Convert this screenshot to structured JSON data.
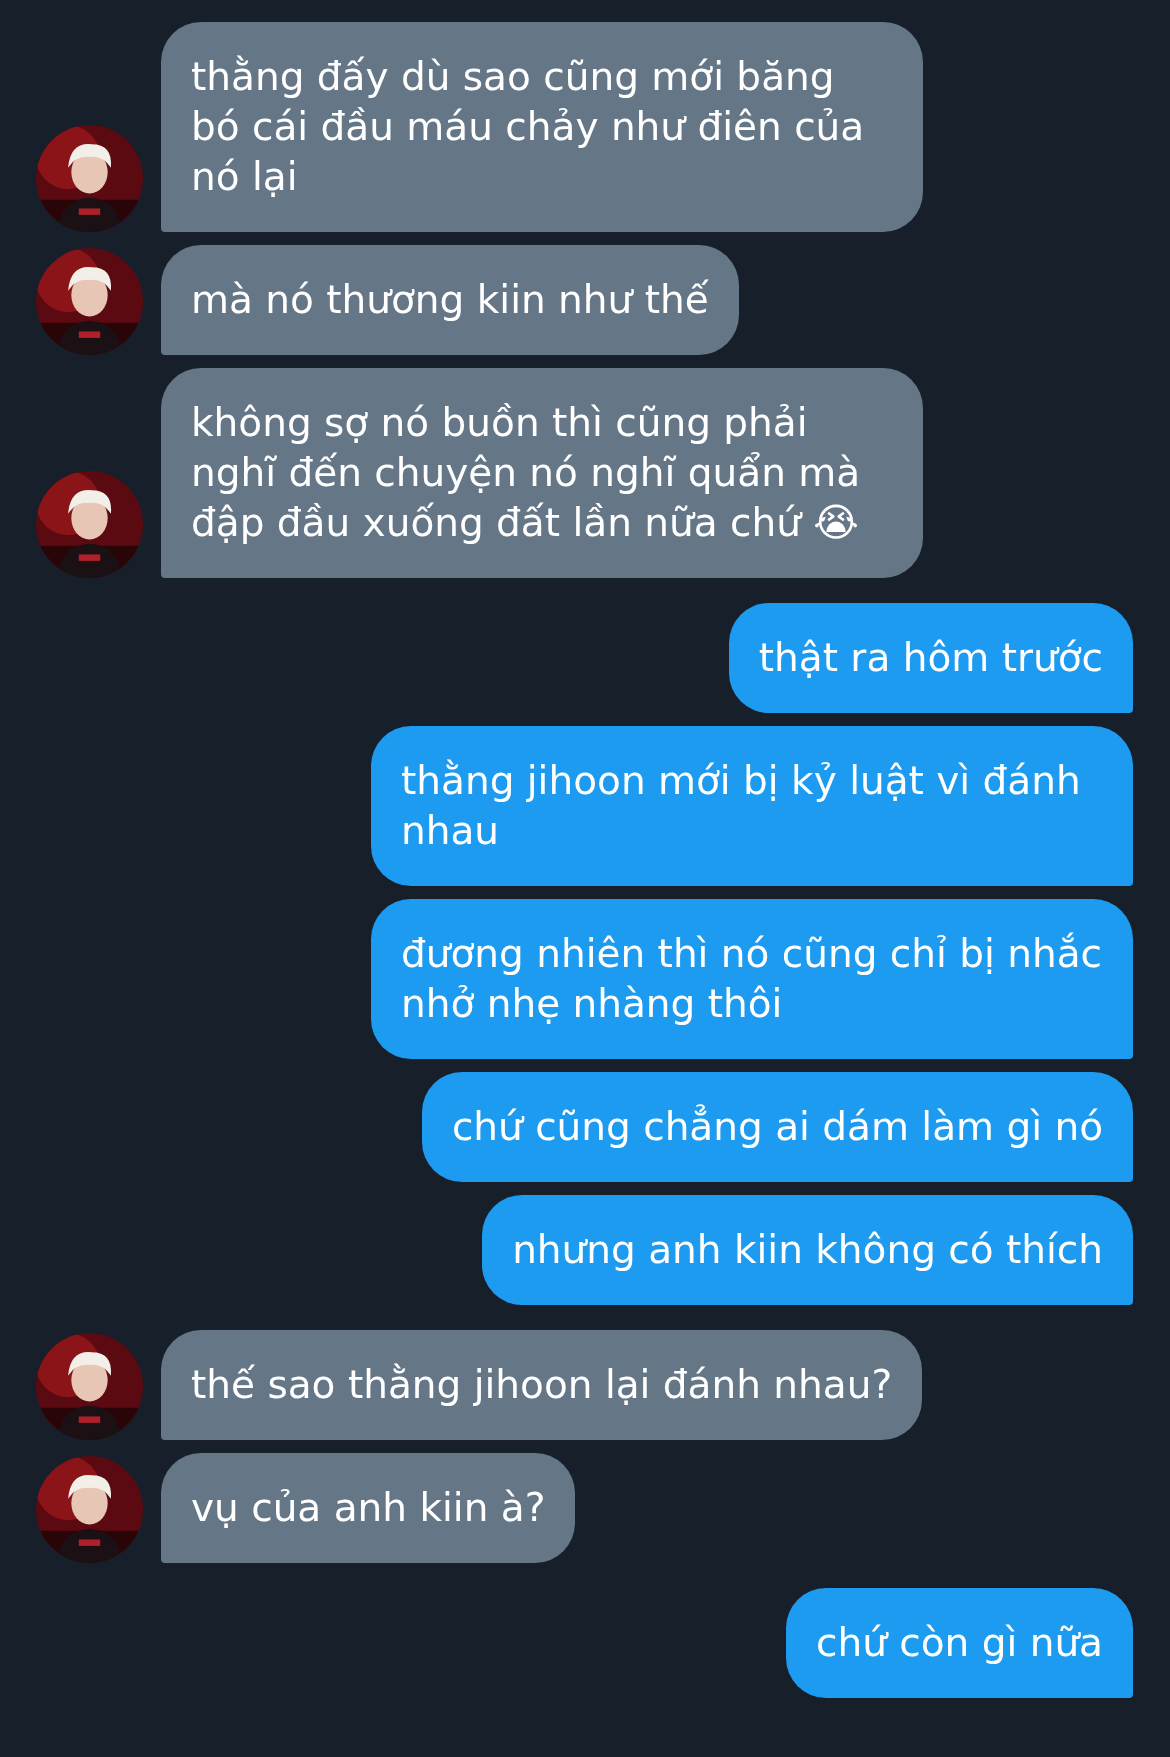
{
  "messages": [
    {
      "kind": "them",
      "text": "thằng đấy dù sao cũng mới băng bó cái đầu máu chảy như điên của nó lại"
    },
    {
      "kind": "them",
      "text": "mà nó thương kiin như thế"
    },
    {
      "kind": "them",
      "text": "không sợ nó buồn thì cũng phải nghĩ đến chuyện nó nghĩ quẩn mà đập đầu xuống đất lần nữa chứ 😭"
    },
    {
      "kind": "me",
      "text": "thật ra hôm trước"
    },
    {
      "kind": "me",
      "text": "thằng jihoon mới bị kỷ luật vì đánh nhau"
    },
    {
      "kind": "me",
      "text": "đương nhiên thì nó cũng chỉ bị nhắc nhở nhẹ nhàng thôi"
    },
    {
      "kind": "me",
      "text": "chứ cũng chẳng ai dám làm gì nó"
    },
    {
      "kind": "me",
      "text": "nhưng anh kiin không có thích"
    },
    {
      "kind": "them",
      "text": "thế sao thằng jihoon lại đánh nhau?"
    },
    {
      "kind": "them",
      "text": "vụ của anh kiin à?"
    },
    {
      "kind": "me",
      "text": "chứ còn gì nữa"
    }
  ]
}
